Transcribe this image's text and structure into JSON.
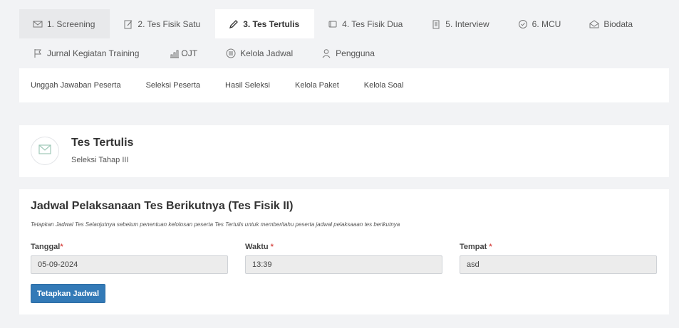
{
  "top_tabs": [
    {
      "label": "1. Screening",
      "icon": "envelope-icon"
    },
    {
      "label": "2. Tes Fisik Satu",
      "icon": "edit-icon"
    },
    {
      "label": "3. Tes Tertulis",
      "icon": "pencil-icon"
    },
    {
      "label": "4. Tes Fisik Dua",
      "icon": "tablet-icon"
    },
    {
      "label": "5. Interview",
      "icon": "clipboard-icon"
    },
    {
      "label": "6. MCU",
      "icon": "check-circle-icon"
    },
    {
      "label": "Biodata",
      "icon": "envelope-open-icon"
    }
  ],
  "second_tabs": [
    {
      "label": "Jurnal Kegiatan Training",
      "icon": "flag-icon"
    },
    {
      "label": "OJT",
      "icon": "bar-chart-icon"
    },
    {
      "label": "Kelola Jadwal",
      "icon": "list-circle-icon"
    },
    {
      "label": "Pengguna",
      "icon": "user-icon"
    }
  ],
  "sub_nav": [
    "Unggah Jawaban Peserta",
    "Seleksi Peserta",
    "Hasil Seleksi",
    "Kelola Paket",
    "Kelola Soal"
  ],
  "header_card": {
    "icon": "envelope-icon",
    "title": "Tes Tertulis",
    "subtitle": "Seleksi Tahap III"
  },
  "schedule": {
    "title": "Jadwal Pelaksanaan Tes Berikutnya (Tes Fisik II)",
    "note": "Tetapkan Jadwal Tes Selanjutnya sebelum penentuan kelolosan peserta Tes Tertulis untuk memberitahu peserta jadwal pelaksaaan tes berikutnya",
    "fields": {
      "tanggal": {
        "label": "Tanggal",
        "required_mark": "*",
        "value": "05-09-2024"
      },
      "waktu": {
        "label": "Waktu",
        "required_mark": " *",
        "value": "13:39"
      },
      "tempat": {
        "label": "Tempat",
        "required_mark": " *",
        "value": "asd"
      }
    },
    "button": "Tetapkan Jadwal"
  },
  "colors": {
    "primary": "#337ab7",
    "required": "#d9534f",
    "page_bg": "#f2f3f5"
  }
}
